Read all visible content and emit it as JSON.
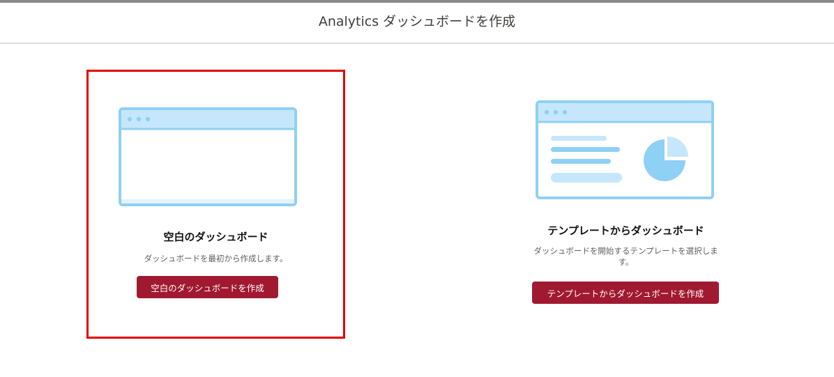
{
  "header": {
    "title": "Analytics ダッシュボードを作成"
  },
  "cards": [
    {
      "title": "空白のダッシュボード",
      "description": "ダッシュボードを最初から作成します。",
      "button_label": "空白のダッシュボードを作成",
      "illustration": "blank-dashboard-illustration"
    },
    {
      "title": "テンプレートからダッシュボード",
      "description_line1": "ダッシュボードを開始するテンプレートを選択しま",
      "description_line2": "す。",
      "button_label": "テンプレートからダッシュボードを作成",
      "illustration": "template-dashboard-illustration"
    }
  ],
  "colors": {
    "accent": "#a01930",
    "highlight_border": "#e00000",
    "illustration_stroke": "#8fd0f5",
    "illustration_fill": "#c6e7fb"
  }
}
